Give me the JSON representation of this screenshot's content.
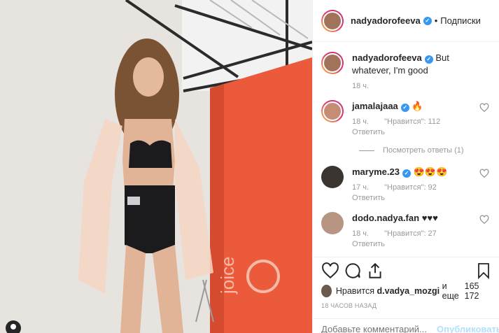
{
  "header": {
    "username": "nadyadorofeeva",
    "separator": "•",
    "follow_label": "Подписки"
  },
  "photo": {
    "brand_text": "joice"
  },
  "caption": {
    "username": "nadyadorofeeva",
    "text": "But whatever, I'm good",
    "time": "18 ч."
  },
  "comments": [
    {
      "username": "jamalajaaa",
      "text": "🔥",
      "time": "18 ч.",
      "likes": "\"Нравится\": 112",
      "reply": "Ответить"
    },
    {
      "username": "maryme.23",
      "text": "😍😍😍",
      "time": "17 ч.",
      "likes": "\"Нравится\": 92",
      "reply": "Ответить"
    },
    {
      "username": "dodo.nadya.fan",
      "text": "♥♥♥",
      "time": "18 ч.",
      "likes": "\"Нравится\": 27",
      "reply": "Ответить"
    }
  ],
  "view_replies": "Посмотреть ответы (1)",
  "likes": {
    "prefix": "Нравится",
    "user": "d.vadya_mozgi",
    "suffix": "и еще",
    "count": "165 172"
  },
  "time_ago": "18 ЧАСОВ НАЗАД",
  "composer": {
    "placeholder": "Добавьте комментарий...",
    "publish_label": "Опубликовать"
  },
  "colors": {
    "verified": "#3897f0",
    "backdrop": "#ec5a3c",
    "publish": "#b2dffc"
  }
}
